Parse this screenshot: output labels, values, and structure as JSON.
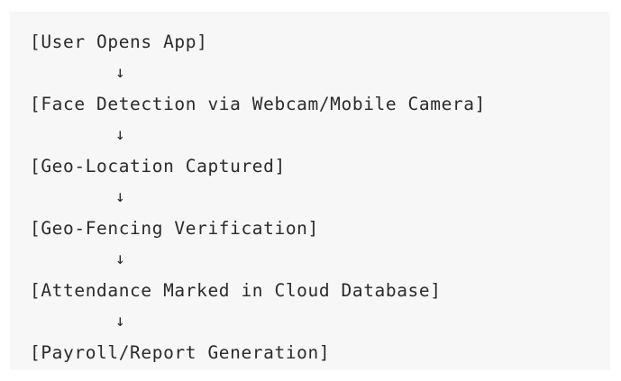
{
  "flow": {
    "steps": [
      "[User Opens App]",
      "[Face Detection via Webcam/Mobile Camera]",
      "[Geo-Location Captured]",
      "[Geo-Fencing Verification]",
      "[Attendance Marked in Cloud Database]",
      "[Payroll/Report Generation]"
    ],
    "arrow": "↓"
  },
  "colors": {
    "panel_background": "#f7f7f7",
    "text": "#2b2b2b"
  },
  "icons": {
    "arrow": "arrow-down-icon"
  }
}
